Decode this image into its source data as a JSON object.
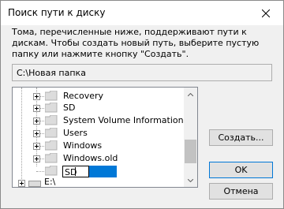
{
  "window": {
    "title": "Поиск пути к диску",
    "description": "Тома, перечисленные ниже, поддерживают пути к дискам. Чтобы создать новый путь, выберите пустую папку или нажмите кнопку \"Создать\"."
  },
  "path": {
    "value": "C:\\Новая папка"
  },
  "tree": {
    "items": [
      {
        "label": "Recovery",
        "expandable": true
      },
      {
        "label": "SD",
        "expandable": true
      },
      {
        "label": "System Volume Information",
        "expandable": true
      },
      {
        "label": "Users",
        "expandable": true
      },
      {
        "label": "Windows",
        "expandable": true
      },
      {
        "label": "Windows.old",
        "expandable": true
      }
    ],
    "editing_item": {
      "value": "SD"
    },
    "drive_partial": "E:\\"
  },
  "buttons": {
    "create": "Создать...",
    "ok": "OK",
    "cancel": "Отмена"
  },
  "colors": {
    "accent": "#0078d7",
    "folder": "#dcdcdc",
    "window_bg": "#f0f0f0"
  }
}
